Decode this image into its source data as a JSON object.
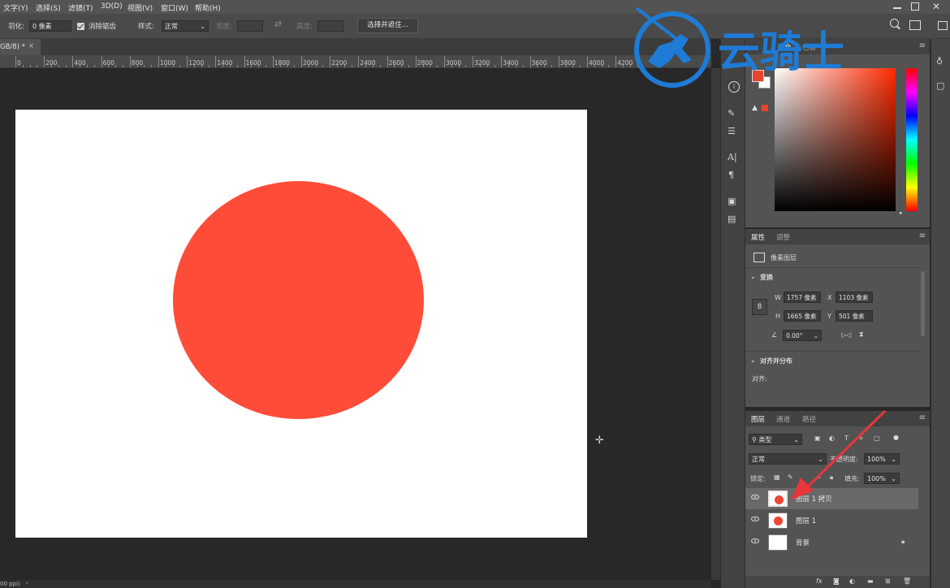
{
  "menu": [
    "文字(Y)",
    "选择(S)",
    "滤镜(T)",
    "3D(D)",
    "视图(V)",
    "窗口(W)",
    "帮助(H)"
  ],
  "options": {
    "feather_label": "羽化:",
    "feather_value": "0 像素",
    "antialias_label": "消除锯齿",
    "style_label": "样式:",
    "style_value": "正常",
    "width_label": "宽度:",
    "height_label": "高度:",
    "select_mask_button": "选择并遮住..."
  },
  "document": {
    "tab_title": "GB/8) *",
    "close_glyph": "×"
  },
  "ruler_ticks": [
    "0",
    "200",
    "400",
    "600",
    "800",
    "1000",
    "1200",
    "1400",
    "1600",
    "1800",
    "2000",
    "2200",
    "2400",
    "2600",
    "2800",
    "3000",
    "3200",
    "3400",
    "3600",
    "3800",
    "4000",
    "4200"
  ],
  "canvas": {
    "background_color": "#ffffff",
    "shape_color": "#ff4c38"
  },
  "status_text": "00 ppi)",
  "watermark": {
    "text": "云骑士",
    "color": "#1e7bd6"
  },
  "color_panel": {
    "tab_color": "颜色",
    "tab_swatches": "色板",
    "foreground": "#e8442f",
    "background": "#ffffff"
  },
  "properties": {
    "tab_properties": "属性",
    "tab_adjust": "调整",
    "layer_type": "像素图层",
    "transform_title": "变换",
    "w_label": "W",
    "w_value": "1757 像素",
    "x_label": "X",
    "x_value": "1103 像素",
    "h_label": "H",
    "h_value": "1665 像素",
    "y_label": "Y",
    "y_value": "501 像素",
    "angle_value": "0.00°",
    "align_title": "对齐并分布",
    "align_label": "对齐:"
  },
  "layers_panel": {
    "tab_layers": "图层",
    "tab_channels": "通道",
    "tab_paths": "路径",
    "filter_value": "类型",
    "blend_mode": "正常",
    "opacity_label": "不透明度:",
    "opacity_value": "100%",
    "lock_label": "锁定:",
    "fill_label": "填充:",
    "fill_value": "100%",
    "layers": [
      {
        "name": "图层 1 拷贝",
        "selected": true,
        "content": "red-circle"
      },
      {
        "name": "图层 1",
        "selected": false,
        "content": "red-circle"
      },
      {
        "name": "背景",
        "selected": false,
        "content": "white",
        "locked": true
      }
    ]
  },
  "annotation_arrow_color": "#e8363a"
}
